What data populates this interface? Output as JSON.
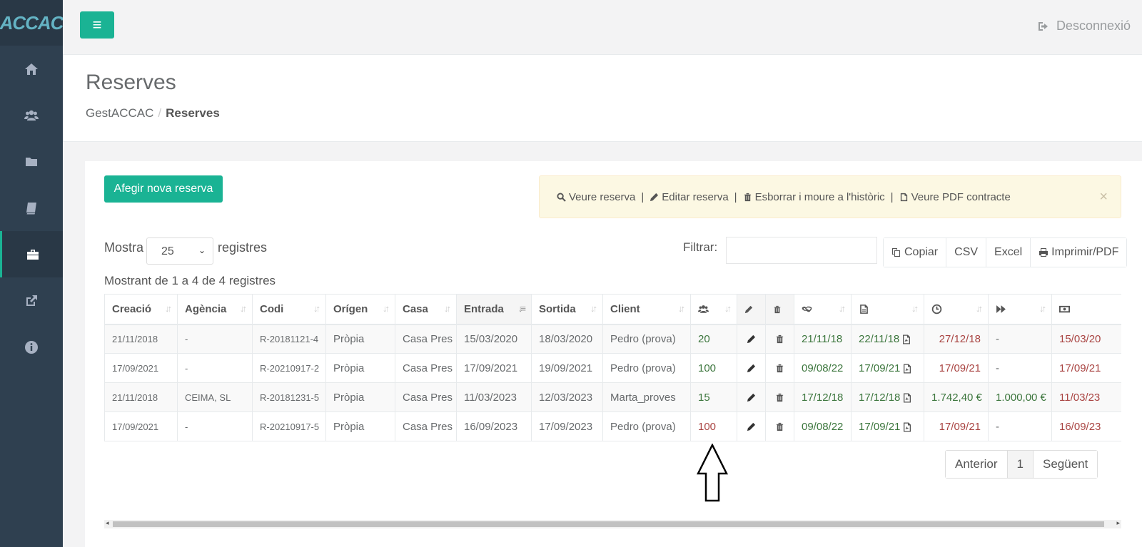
{
  "brand": {
    "logo_text": "ACCAC"
  },
  "sidebar": {
    "items": [
      {
        "name": "home-icon"
      },
      {
        "name": "users-icon"
      },
      {
        "name": "folder-icon"
      },
      {
        "name": "book-icon"
      },
      {
        "name": "briefcase-icon",
        "active": true
      },
      {
        "name": "external-link-icon"
      },
      {
        "name": "info-icon"
      }
    ]
  },
  "topbar": {
    "logout_label": "Desconnexió"
  },
  "header": {
    "title": "Reserves",
    "breadcrumb": [
      "GestACCAC",
      "Reserves"
    ]
  },
  "toolbar": {
    "add_label": "Afegir nova reserva"
  },
  "legend": {
    "items": [
      "Veure reserva",
      "Editar reserva",
      "Esborrar i moure a l'històric",
      "Veure PDF contracte"
    ],
    "close": "×"
  },
  "length": {
    "prefix": "Mostra",
    "value": "25",
    "suffix": "registres"
  },
  "filter": {
    "label": "Filtrar:",
    "value": ""
  },
  "export": {
    "copy": "Copiar",
    "csv": "CSV",
    "excel": "Excel",
    "print": "Imprimir/PDF"
  },
  "info": "Mostrant de 1 a 4 de 4 registres",
  "table": {
    "headers": [
      "Creació",
      "Agència",
      "Codi",
      "Orígen",
      "Casa",
      "Entrada",
      "Sortida",
      "Client"
    ],
    "rows": [
      {
        "creacio": "21/11/2018",
        "agencia": "-",
        "codi": "R-20181121-4",
        "origen": "Pròpia",
        "casa": "Casa Pres",
        "entrada": "15/03/2020",
        "sortida": "18/03/2020",
        "client": "Pedro (prova)",
        "pax": "20",
        "d1": "21/11/18",
        "d2": "22/11/18",
        "d3": "27/12/18",
        "d4": "-",
        "d5": "15/03/20"
      },
      {
        "creacio": "17/09/2021",
        "agencia": "-",
        "codi": "R-20210917-2",
        "origen": "Pròpia",
        "casa": "Casa Pres",
        "entrada": "17/09/2021",
        "sortida": "19/09/2021",
        "client": "Pedro (prova)",
        "pax": "100",
        "d1": "09/08/22",
        "d2": "17/09/21",
        "d3": "17/09/21",
        "d4": "-",
        "d5": "17/09/21"
      },
      {
        "creacio": "21/11/2018",
        "agencia": "CEIMA, SL",
        "codi": "R-20181231-5",
        "origen": "Pròpia",
        "casa": "Casa Pres",
        "entrada": "11/03/2023",
        "sortida": "12/03/2023",
        "client": "Marta_proves",
        "pax": "15",
        "d1": "17/12/18",
        "d2": "17/12/18",
        "d3": "1.742,40 €",
        "d4": "1.000,00 €",
        "d5": "11/03/23"
      },
      {
        "creacio": "17/09/2021",
        "agencia": "-",
        "codi": "R-20210917-5",
        "origen": "Pròpia",
        "casa": "Casa Pres",
        "entrada": "16/09/2023",
        "sortida": "17/09/2023",
        "client": "Pedro (prova)",
        "pax": "100",
        "d1": "09/08/22",
        "d2": "17/09/21",
        "d3": "17/09/21",
        "d4": "-",
        "d5": "16/09/23"
      }
    ]
  },
  "pagination": {
    "prev": "Anterior",
    "page": "1",
    "next": "Següent"
  },
  "colors": {
    "accent": "#1ab394",
    "sidebar": "#2f4050",
    "green_text": "#3c763d",
    "red_text": "#a94442",
    "legend_bg": "#fcf8e3"
  }
}
